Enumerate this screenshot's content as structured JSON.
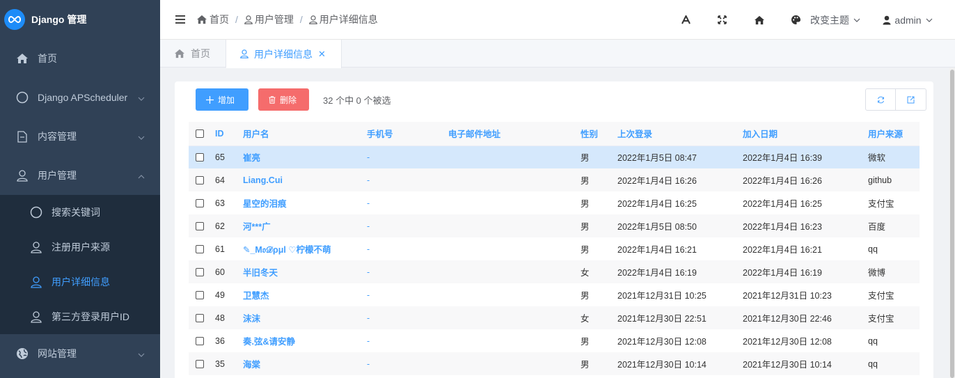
{
  "sidebar": {
    "logo_text": "Django 管理",
    "items": [
      {
        "label": "首页",
        "icon": "home-icon"
      },
      {
        "label": "Django APScheduler",
        "icon": "circle-icon"
      },
      {
        "label": "内容管理",
        "icon": "document-icon"
      },
      {
        "label": "用户管理",
        "icon": "user-icon"
      }
    ],
    "submenu": [
      {
        "label": "搜索关键词",
        "icon": "circle-icon"
      },
      {
        "label": "注册用户来源",
        "icon": "user-icon"
      },
      {
        "label": "用户详细信息",
        "icon": "user-icon",
        "active": true
      },
      {
        "label": "第三方登录用户ID",
        "icon": "user-icon"
      }
    ],
    "last_item": {
      "label": "网站管理",
      "icon": "globe-icon"
    }
  },
  "header": {
    "breadcrumb": [
      "首页",
      "用户管理",
      "用户详细信息"
    ],
    "theme_label": "改变主题",
    "user_label": "admin"
  },
  "tabs": [
    {
      "label": "首页",
      "active": false
    },
    {
      "label": "用户详细信息",
      "active": true
    }
  ],
  "toolbar": {
    "add_label": "增加",
    "delete_label": "删除",
    "selection_text": "32 个中 0 个被选"
  },
  "table": {
    "columns": [
      "ID",
      "用户名",
      "手机号",
      "电子邮件地址",
      "性别",
      "上次登录",
      "加入日期",
      "用户来源"
    ],
    "rows": [
      {
        "id": "65",
        "username": "崔亮",
        "phone": "-",
        "email": "",
        "gender": "男",
        "last_login": "2022年1月5日 08:47",
        "joined": "2022年1月4日 16:39",
        "source": "微软"
      },
      {
        "id": "64",
        "username": "Liang.Cui",
        "phone": "-",
        "email": "",
        "gender": "男",
        "last_login": "2022年1月4日 16:26",
        "joined": "2022年1月4日 16:26",
        "source": "github"
      },
      {
        "id": "63",
        "username": "星空的泪痕",
        "phone": "-",
        "email": "",
        "gender": "男",
        "last_login": "2022年1月4日 16:25",
        "joined": "2022年1月4日 16:25",
        "source": "支付宝"
      },
      {
        "id": "62",
        "username": "河***广",
        "phone": "-",
        "email": "",
        "gender": "男",
        "last_login": "2022年1月5日 08:50",
        "joined": "2022年1月4日 16:23",
        "source": "百度"
      },
      {
        "id": "61",
        "username": "✎_M𝔬𝒟ρμl ♡柠檬不萌",
        "phone": "-",
        "email": "",
        "gender": "男",
        "last_login": "2022年1月4日 16:21",
        "joined": "2022年1月4日 16:21",
        "source": "qq"
      },
      {
        "id": "60",
        "username": "半旧冬天",
        "phone": "-",
        "email": "",
        "gender": "女",
        "last_login": "2022年1月4日 16:19",
        "joined": "2022年1月4日 16:19",
        "source": "微博"
      },
      {
        "id": "49",
        "username": "卫慧杰",
        "phone": "-",
        "email": "",
        "gender": "男",
        "last_login": "2021年12月31日 10:25",
        "joined": "2021年12月31日 10:23",
        "source": "支付宝"
      },
      {
        "id": "48",
        "username": "沫沫",
        "phone": "-",
        "email": "",
        "gender": "女",
        "last_login": "2021年12月30日 22:51",
        "joined": "2021年12月30日 22:46",
        "source": "支付宝"
      },
      {
        "id": "36",
        "username": "奏.弦&请安静",
        "phone": "-",
        "email": "",
        "gender": "男",
        "last_login": "2021年12月30日 12:08",
        "joined": "2021年12月30日 12:08",
        "source": "qq"
      },
      {
        "id": "35",
        "username": "海棠",
        "phone": "-",
        "email": "",
        "gender": "男",
        "last_login": "2021年12月30日 10:14",
        "joined": "2021年12月30日 10:14",
        "source": "qq"
      }
    ]
  },
  "colors": {
    "accent": "#409eff",
    "danger": "#f56c6c",
    "sidebar_bg": "#304156",
    "selected_row": "#d5e8fc"
  }
}
